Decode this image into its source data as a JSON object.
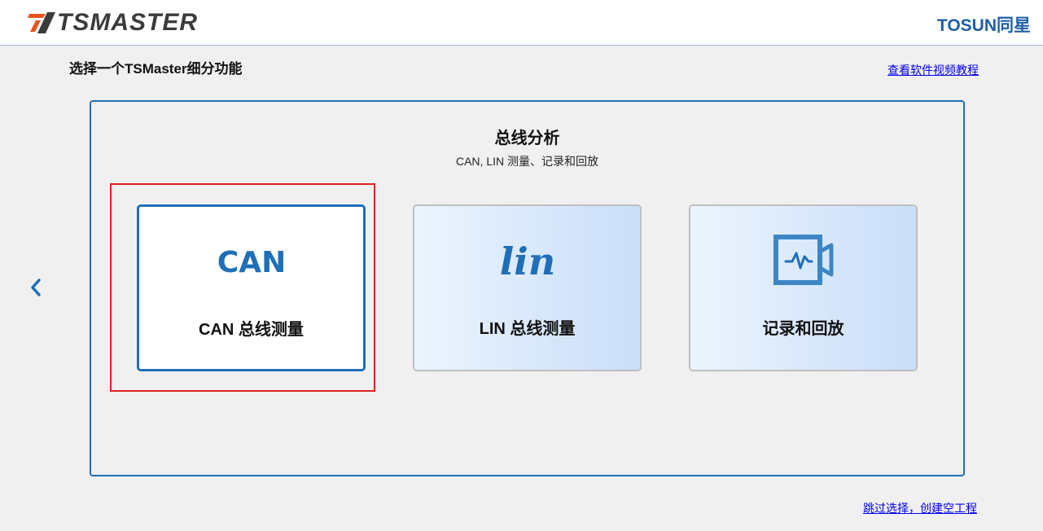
{
  "header": {
    "logo_text": "TSMASTER",
    "brand_text": "TOSUN同星"
  },
  "page": {
    "title": "选择一个TSMaster细分功能",
    "video_link": "查看软件视频教程",
    "skip_link": "跳过选择，创建空工程"
  },
  "panel": {
    "title": "总线分析",
    "subtitle": "CAN, LIN 测量、记录和回放"
  },
  "cards": [
    {
      "icon": "can-logo-icon",
      "icon_text": "CAN",
      "label": "CAN 总线测量",
      "selected": true
    },
    {
      "icon": "lin-logo-icon",
      "icon_text": "lin",
      "label": "LIN 总线测量",
      "selected": false
    },
    {
      "icon": "record-replay-icon",
      "label": "记录和回放",
      "selected": false
    }
  ],
  "nav": {
    "prev_icon": "chevron-left-icon"
  },
  "colors": {
    "accent": "#1f6fb8",
    "selection": "#e02020",
    "link": "#0000ee",
    "card_gradient_start": "#ecf4fd",
    "card_gradient_end": "#c9def9"
  }
}
